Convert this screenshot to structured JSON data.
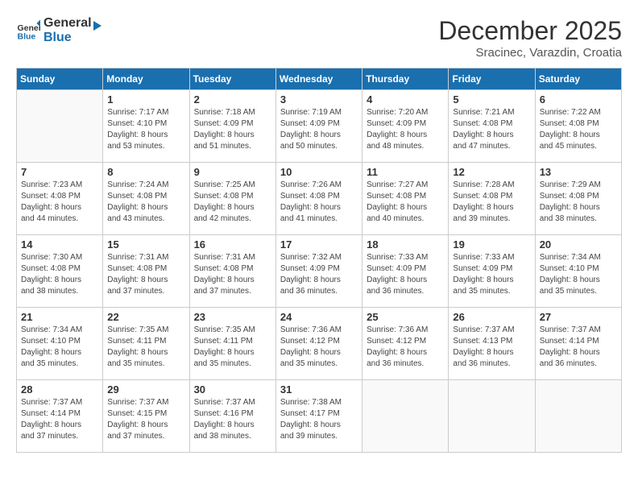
{
  "header": {
    "logo_general": "General",
    "logo_blue": "Blue",
    "month_year": "December 2025",
    "location": "Sracinec, Varazdin, Croatia"
  },
  "days_of_week": [
    "Sunday",
    "Monday",
    "Tuesday",
    "Wednesday",
    "Thursday",
    "Friday",
    "Saturday"
  ],
  "weeks": [
    [
      {
        "day": "",
        "info": ""
      },
      {
        "day": "1",
        "info": "Sunrise: 7:17 AM\nSunset: 4:10 PM\nDaylight: 8 hours\nand 53 minutes."
      },
      {
        "day": "2",
        "info": "Sunrise: 7:18 AM\nSunset: 4:09 PM\nDaylight: 8 hours\nand 51 minutes."
      },
      {
        "day": "3",
        "info": "Sunrise: 7:19 AM\nSunset: 4:09 PM\nDaylight: 8 hours\nand 50 minutes."
      },
      {
        "day": "4",
        "info": "Sunrise: 7:20 AM\nSunset: 4:09 PM\nDaylight: 8 hours\nand 48 minutes."
      },
      {
        "day": "5",
        "info": "Sunrise: 7:21 AM\nSunset: 4:08 PM\nDaylight: 8 hours\nand 47 minutes."
      },
      {
        "day": "6",
        "info": "Sunrise: 7:22 AM\nSunset: 4:08 PM\nDaylight: 8 hours\nand 45 minutes."
      }
    ],
    [
      {
        "day": "7",
        "info": "Sunrise: 7:23 AM\nSunset: 4:08 PM\nDaylight: 8 hours\nand 44 minutes."
      },
      {
        "day": "8",
        "info": "Sunrise: 7:24 AM\nSunset: 4:08 PM\nDaylight: 8 hours\nand 43 minutes."
      },
      {
        "day": "9",
        "info": "Sunrise: 7:25 AM\nSunset: 4:08 PM\nDaylight: 8 hours\nand 42 minutes."
      },
      {
        "day": "10",
        "info": "Sunrise: 7:26 AM\nSunset: 4:08 PM\nDaylight: 8 hours\nand 41 minutes."
      },
      {
        "day": "11",
        "info": "Sunrise: 7:27 AM\nSunset: 4:08 PM\nDaylight: 8 hours\nand 40 minutes."
      },
      {
        "day": "12",
        "info": "Sunrise: 7:28 AM\nSunset: 4:08 PM\nDaylight: 8 hours\nand 39 minutes."
      },
      {
        "day": "13",
        "info": "Sunrise: 7:29 AM\nSunset: 4:08 PM\nDaylight: 8 hours\nand 38 minutes."
      }
    ],
    [
      {
        "day": "14",
        "info": "Sunrise: 7:30 AM\nSunset: 4:08 PM\nDaylight: 8 hours\nand 38 minutes."
      },
      {
        "day": "15",
        "info": "Sunrise: 7:31 AM\nSunset: 4:08 PM\nDaylight: 8 hours\nand 37 minutes."
      },
      {
        "day": "16",
        "info": "Sunrise: 7:31 AM\nSunset: 4:08 PM\nDaylight: 8 hours\nand 37 minutes."
      },
      {
        "day": "17",
        "info": "Sunrise: 7:32 AM\nSunset: 4:09 PM\nDaylight: 8 hours\nand 36 minutes."
      },
      {
        "day": "18",
        "info": "Sunrise: 7:33 AM\nSunset: 4:09 PM\nDaylight: 8 hours\nand 36 minutes."
      },
      {
        "day": "19",
        "info": "Sunrise: 7:33 AM\nSunset: 4:09 PM\nDaylight: 8 hours\nand 35 minutes."
      },
      {
        "day": "20",
        "info": "Sunrise: 7:34 AM\nSunset: 4:10 PM\nDaylight: 8 hours\nand 35 minutes."
      }
    ],
    [
      {
        "day": "21",
        "info": "Sunrise: 7:34 AM\nSunset: 4:10 PM\nDaylight: 8 hours\nand 35 minutes."
      },
      {
        "day": "22",
        "info": "Sunrise: 7:35 AM\nSunset: 4:11 PM\nDaylight: 8 hours\nand 35 minutes."
      },
      {
        "day": "23",
        "info": "Sunrise: 7:35 AM\nSunset: 4:11 PM\nDaylight: 8 hours\nand 35 minutes."
      },
      {
        "day": "24",
        "info": "Sunrise: 7:36 AM\nSunset: 4:12 PM\nDaylight: 8 hours\nand 35 minutes."
      },
      {
        "day": "25",
        "info": "Sunrise: 7:36 AM\nSunset: 4:12 PM\nDaylight: 8 hours\nand 36 minutes."
      },
      {
        "day": "26",
        "info": "Sunrise: 7:37 AM\nSunset: 4:13 PM\nDaylight: 8 hours\nand 36 minutes."
      },
      {
        "day": "27",
        "info": "Sunrise: 7:37 AM\nSunset: 4:14 PM\nDaylight: 8 hours\nand 36 minutes."
      }
    ],
    [
      {
        "day": "28",
        "info": "Sunrise: 7:37 AM\nSunset: 4:14 PM\nDaylight: 8 hours\nand 37 minutes."
      },
      {
        "day": "29",
        "info": "Sunrise: 7:37 AM\nSunset: 4:15 PM\nDaylight: 8 hours\nand 37 minutes."
      },
      {
        "day": "30",
        "info": "Sunrise: 7:37 AM\nSunset: 4:16 PM\nDaylight: 8 hours\nand 38 minutes."
      },
      {
        "day": "31",
        "info": "Sunrise: 7:38 AM\nSunset: 4:17 PM\nDaylight: 8 hours\nand 39 minutes."
      },
      {
        "day": "",
        "info": ""
      },
      {
        "day": "",
        "info": ""
      },
      {
        "day": "",
        "info": ""
      }
    ]
  ]
}
